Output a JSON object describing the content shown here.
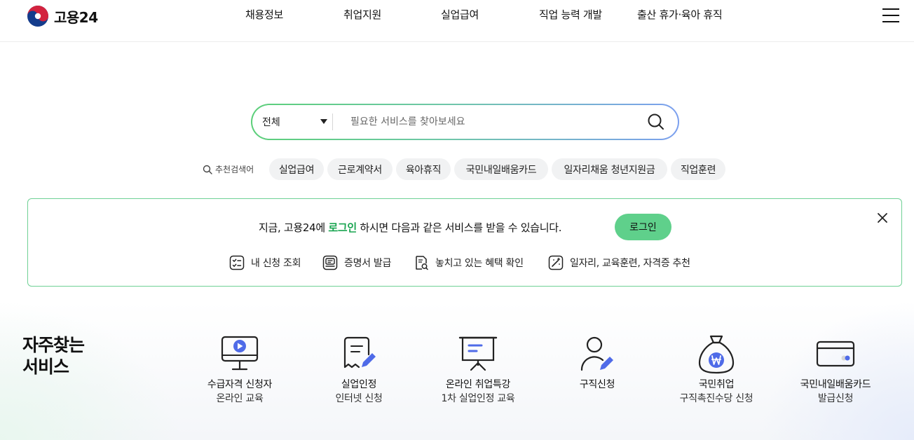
{
  "header": {
    "logo_text": "고용24",
    "nav": [
      "채용정보",
      "취업지원",
      "실업급여",
      "직업 능력 개발",
      "출산 휴가·육아 휴직"
    ],
    "menu_icon": "hamburger-menu-icon"
  },
  "search": {
    "scope_value": "전체",
    "placeholder": "필요한 서비스를 찾아보세요",
    "button_icon": "search-icon",
    "border_colors": [
      "#5ccf7a",
      "#7ca0ef"
    ]
  },
  "recommend": {
    "label": "추천검색어",
    "keywords": [
      "실업급여",
      "근로계약서",
      "육아휴직",
      "국민내일배움카드",
      "일자리채움 청년지원금",
      "직업훈련"
    ]
  },
  "login_banner": {
    "msg_before": "지금, 고용24에 ",
    "msg_highlight": "로그인",
    "msg_after": " 하시면 다음과 같은 서비스를 받을 수 있습니다.",
    "button_label": "로그인",
    "close_icon": "close-icon",
    "benefits": [
      {
        "icon": "checklist-icon",
        "label": "내 신청 조회"
      },
      {
        "icon": "certificate-icon",
        "label": "증명서 발급"
      },
      {
        "icon": "document-search-icon",
        "label": "놓치고 있는 혜택 확인"
      },
      {
        "icon": "magic-wand-icon",
        "label": "일자리, 교육훈련, 자격증 추천"
      }
    ],
    "accent_color": "#1aa551",
    "button_color": "#5fd08b"
  },
  "frequent": {
    "title_line1": "자주찾는",
    "title_line2": "서비스",
    "services": [
      {
        "icon": "monitor-play-icon",
        "line1": "수급자격 신청자",
        "line2": "온라인 교육"
      },
      {
        "icon": "document-pen-icon",
        "line1": "실업인정",
        "line2": "인터넷 신청"
      },
      {
        "icon": "presentation-board-icon",
        "line1": "온라인 취업특강",
        "line2": "1차 실업인정 교육"
      },
      {
        "icon": "person-pen-icon",
        "line1": "구직신청",
        "line2": ""
      },
      {
        "icon": "money-bag-won-icon",
        "line1": "국민취업",
        "line2": "구직촉진수당 신청"
      },
      {
        "icon": "card-icon",
        "line1": "국민내일배움카드",
        "line2": "발급신청"
      }
    ],
    "icon_accent": "#4f6be8"
  }
}
